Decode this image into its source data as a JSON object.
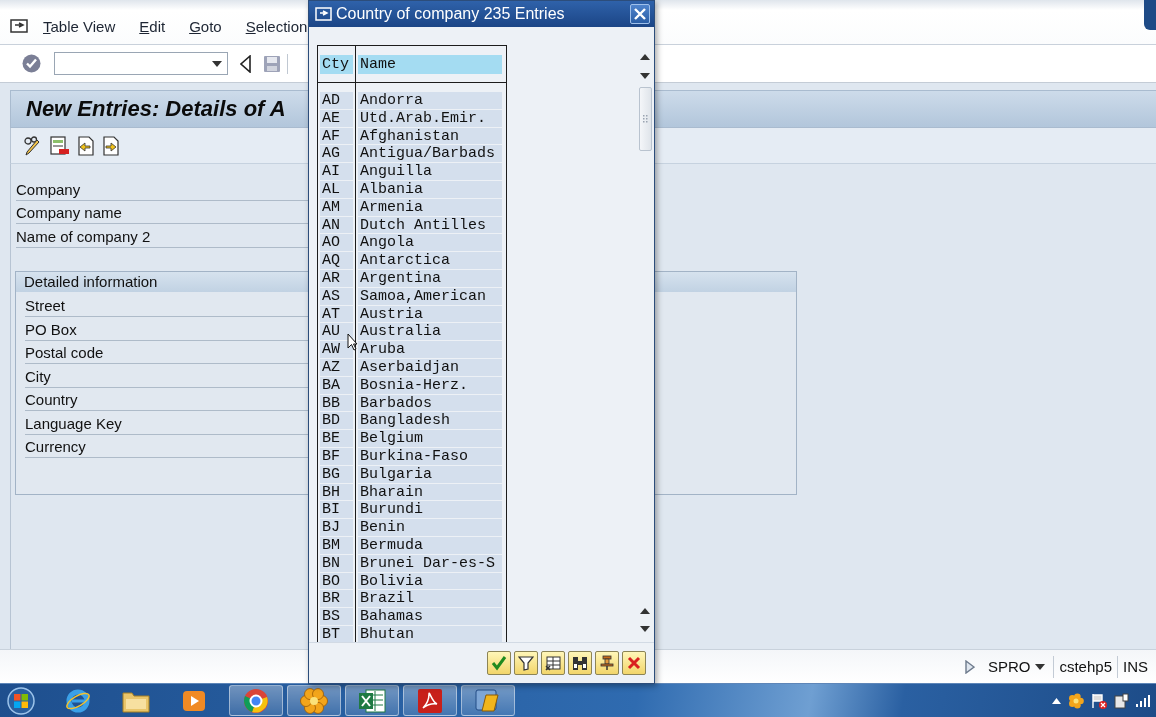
{
  "menu_bar": {
    "items": [
      "Table View",
      "Edit",
      "Goto",
      "Selection"
    ]
  },
  "title": "New Entries: Details of A",
  "header_fields": [
    "Company",
    "Company name",
    "Name of company 2"
  ],
  "detail_group": {
    "title": "Detailed information",
    "fields": [
      "Street",
      "PO Box",
      "Postal code",
      "City",
      "Country",
      "Language Key",
      "Currency"
    ]
  },
  "status_bar": {
    "transaction": "SPRO",
    "system": "cstehp5",
    "mode": "INS"
  },
  "popup": {
    "title": "Country of company 235 Entries",
    "columns": [
      "Cty",
      "Name"
    ],
    "rows": [
      {
        "cty": "AD",
        "name": "Andorra"
      },
      {
        "cty": "AE",
        "name": "Utd.Arab.Emir."
      },
      {
        "cty": "AF",
        "name": "Afghanistan"
      },
      {
        "cty": "AG",
        "name": "Antigua/Barbads"
      },
      {
        "cty": "AI",
        "name": "Anguilla"
      },
      {
        "cty": "AL",
        "name": "Albania"
      },
      {
        "cty": "AM",
        "name": "Armenia"
      },
      {
        "cty": "AN",
        "name": "Dutch Antilles"
      },
      {
        "cty": "AO",
        "name": "Angola"
      },
      {
        "cty": "AQ",
        "name": "Antarctica"
      },
      {
        "cty": "AR",
        "name": "Argentina"
      },
      {
        "cty": "AS",
        "name": "Samoa,American"
      },
      {
        "cty": "AT",
        "name": "Austria"
      },
      {
        "cty": "AU",
        "name": "Australia"
      },
      {
        "cty": "AW",
        "name": "Aruba"
      },
      {
        "cty": "AZ",
        "name": "Aserbaidjan"
      },
      {
        "cty": "BA",
        "name": "Bosnia-Herz."
      },
      {
        "cty": "BB",
        "name": "Barbados"
      },
      {
        "cty": "BD",
        "name": "Bangladesh"
      },
      {
        "cty": "BE",
        "name": "Belgium"
      },
      {
        "cty": "BF",
        "name": "Burkina-Faso"
      },
      {
        "cty": "BG",
        "name": "Bulgaria"
      },
      {
        "cty": "BH",
        "name": "Bharain"
      },
      {
        "cty": "BI",
        "name": "Burundi"
      },
      {
        "cty": "BJ",
        "name": "Benin"
      },
      {
        "cty": "BM",
        "name": "Bermuda"
      },
      {
        "cty": "BN",
        "name": "Brunei Dar-es-S"
      },
      {
        "cty": "BO",
        "name": "Bolivia"
      },
      {
        "cty": "BR",
        "name": "Brazil"
      },
      {
        "cty": "BS",
        "name": "Bahamas"
      },
      {
        "cty": "BT",
        "name": "Bhutan"
      }
    ]
  }
}
